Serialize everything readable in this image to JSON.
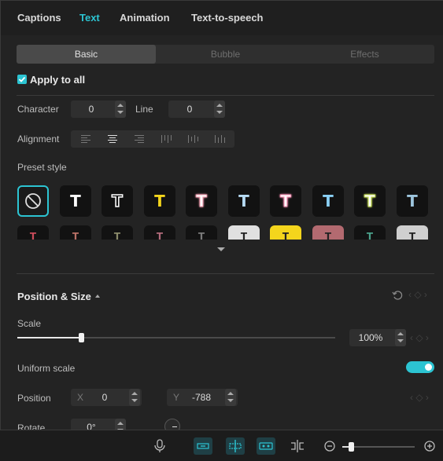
{
  "tabs": [
    "Captions",
    "Text",
    "Animation",
    "Text-to-speech"
  ],
  "active_tab": "Text",
  "segments": [
    "Basic",
    "Bubble",
    "Effects"
  ],
  "apply_all": {
    "label": "Apply to all",
    "checked": true
  },
  "character": {
    "label": "Character",
    "value": "0"
  },
  "line": {
    "label": "Line",
    "value": "0"
  },
  "alignment": {
    "label": "Alignment",
    "selected": "center"
  },
  "preset_style": {
    "label": "Preset style",
    "row1_colors": [
      "none",
      "#ffffff",
      "#ffffff",
      "#f4d51c",
      "#f3a0b3",
      "#b7dcf5",
      "#f58fb3",
      "#8ad0f5",
      "#c8e05a",
      "#9ec6de"
    ],
    "row2_colors": [
      "#c94b5a",
      "#b87066",
      "#8a8a6a",
      "#b06a7a",
      "#7a7a7a",
      "#e0e0e0",
      "#f4d51c",
      "#b36a70",
      "#4aa08a",
      "#cfcfcf"
    ]
  },
  "position_size": {
    "label": "Position & Size"
  },
  "scale": {
    "label": "Scale",
    "value": "100%",
    "fraction": 0.2
  },
  "uniform_scale": {
    "label": "Uniform scale",
    "on": true
  },
  "position": {
    "label": "Position",
    "x_prefix": "X",
    "x_value": "0",
    "y_prefix": "Y",
    "y_value": "-788"
  },
  "rotate": {
    "label": "Rotate",
    "value": "0°"
  },
  "colors": {
    "accent": "#2cc4d2",
    "panel": "#232323",
    "text": "#cfcfcf"
  },
  "bottom_icons": [
    "microphone-icon",
    "link-clip-icon",
    "split-clip-icon",
    "link-track-icon",
    "split-screen-icon",
    "zoom-out-icon",
    "zoom-in-icon"
  ]
}
